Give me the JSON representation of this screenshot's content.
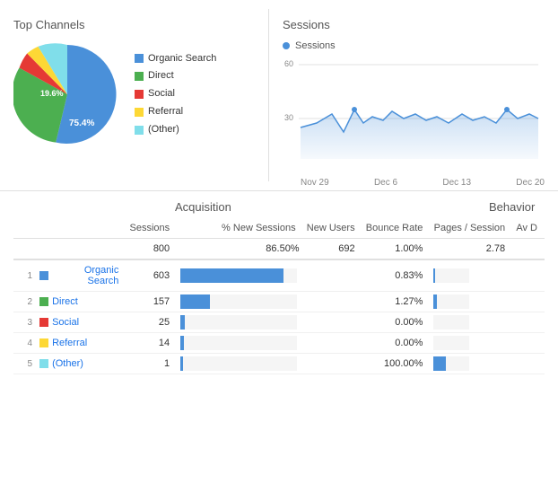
{
  "topChannels": {
    "title": "Top Channels",
    "legend": [
      {
        "label": "Organic Search",
        "color": "#4a90d9",
        "percent": 75.4
      },
      {
        "label": "Direct",
        "color": "#4caf50",
        "percent": 19.6
      },
      {
        "label": "Social",
        "color": "#e53935",
        "percent": 2.5
      },
      {
        "label": "Referral",
        "color": "#fdd835",
        "percent": 1.5
      },
      {
        "label": "(Other)",
        "color": "#80deea",
        "percent": 1.0
      }
    ],
    "pieLabels": {
      "outer": "19.6%",
      "inner": "75.4%"
    }
  },
  "sessions": {
    "title": "Sessions",
    "legendLabel": "Sessions",
    "yLabels": [
      "60",
      "30"
    ],
    "xLabels": [
      "Nov 29",
      "Dec 6",
      "Dec 13",
      "Dec 20"
    ]
  },
  "acquisition": {
    "title": "Acquisition",
    "behavior": "Behavior"
  },
  "table": {
    "headers": {
      "sessions": "Sessions",
      "newSessionsPct": "% New Sessions",
      "newUsers": "New Users",
      "bounceRate": "Bounce Rate",
      "pagesSession": "Pages / Session",
      "avgDuration": "Av D"
    },
    "totalRow": {
      "sessions": "800",
      "newSessionsPct": "86.50%",
      "newUsers": "692",
      "bounceRate": "1.00%",
      "pagesSession": "2.78"
    },
    "rows": [
      {
        "num": "1",
        "channel": "Organic Search",
        "color": "#4a90d9",
        "sessions": "603",
        "newSessionsBar": 88,
        "bounceRate": "0.83%",
        "pagesBar": 3
      },
      {
        "num": "2",
        "channel": "Direct",
        "color": "#4caf50",
        "sessions": "157",
        "newSessionsBar": 25,
        "bounceRate": "1.27%",
        "pagesBar": 8
      },
      {
        "num": "3",
        "channel": "Social",
        "color": "#e53935",
        "sessions": "25",
        "newSessionsBar": 4,
        "bounceRate": "0.00%",
        "pagesBar": 0
      },
      {
        "num": "4",
        "channel": "Referral",
        "color": "#fdd835",
        "sessions": "14",
        "newSessionsBar": 3,
        "bounceRate": "0.00%",
        "pagesBar": 0
      },
      {
        "num": "5",
        "channel": "(Other)",
        "color": "#80deea",
        "sessions": "1",
        "newSessionsBar": 2,
        "bounceRate": "100.00%",
        "pagesBar": 35
      }
    ]
  }
}
